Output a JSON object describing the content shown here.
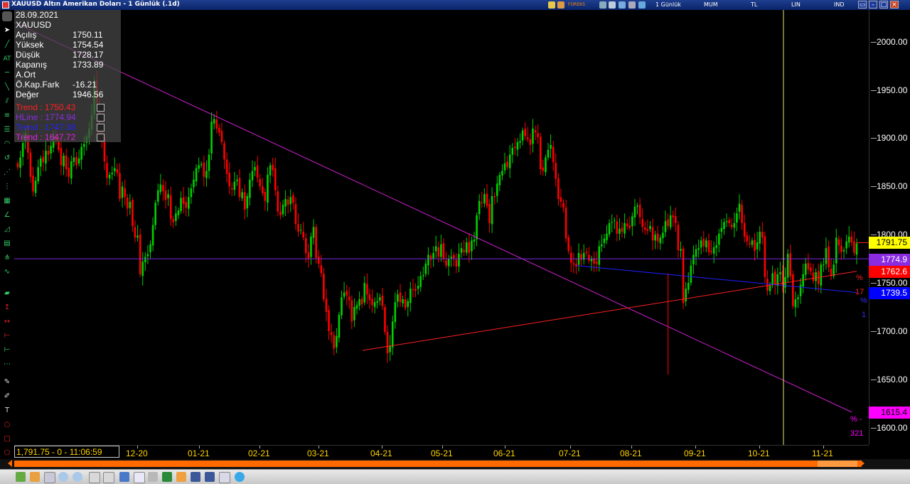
{
  "window": {
    "title": "XAUUSD Altın Amerikan Doları - 1 Günlük (.1d)"
  },
  "toolbar": {
    "period": "1 Günlük",
    "chart_type": "MUM",
    "currency": "TL",
    "scale": "LIN",
    "indicator": "IND",
    "brand": "FOREKS"
  },
  "info_panel": {
    "date": "28.09.2021",
    "symbol": "XAUUSD",
    "rows": [
      {
        "label": "Açılış",
        "value": "1750.11"
      },
      {
        "label": "Yüksek",
        "value": "1754.54"
      },
      {
        "label": "Düşük",
        "value": "1728.17"
      },
      {
        "label": "Kapanış",
        "value": "1733.89"
      },
      {
        "label": "A.Ort",
        "value": ""
      },
      {
        "label": "Ö.Kap.Fark",
        "value": "-16.21"
      },
      {
        "label": "Değer",
        "value": "1946.56"
      }
    ],
    "trends": [
      {
        "text": "Trend : 1750.43",
        "color": "#ff2020"
      },
      {
        "text": "HLine : 1774.94",
        "color": "#8a2be2"
      },
      {
        "text": "Trend : 1747.38",
        "color": "#2020ff"
      },
      {
        "text": "Trend : 1647.72",
        "color": "#e020e0"
      }
    ]
  },
  "status": {
    "value": "1,791.75 - 0 - 11:06:59"
  },
  "price_boxes": [
    {
      "value": "1791.75",
      "bg": "#ffff00",
      "fg": "#000000"
    },
    {
      "value": "1774.9",
      "bg": "#8a2be2",
      "fg": "#ffffff"
    },
    {
      "value": "1762.6",
      "bg": "#ff0000",
      "fg": "#ffffff"
    },
    {
      "value": "1739.5",
      "bg": "#0000ff",
      "fg": "#ffffff"
    },
    {
      "value": "1615.4",
      "bg": "#ff00ff",
      "fg": "#000000"
    }
  ],
  "edge_labels": [
    {
      "text": "%",
      "color": "#ff2020"
    },
    {
      "text": "17",
      "color": "#ff2020"
    },
    {
      "text": "%",
      "color": "#3030ff"
    },
    {
      "text": "1",
      "color": "#3030ff"
    },
    {
      "text": "% -",
      "color": "#ff00ff"
    },
    {
      "text": "321",
      "color": "#ff00ff"
    }
  ],
  "chart_data": {
    "type": "candlestick",
    "x_tick_labels": [
      "12-20",
      "01-21",
      "02-21",
      "03-21",
      "04-21",
      "05-21",
      "06-21",
      "07-21",
      "08-21",
      "09-21",
      "10-21",
      "11-21"
    ],
    "y_tick_labels": [
      "1600.00",
      "1650.00",
      "1700.00",
      "1750.00",
      "1800.00",
      "1850.00",
      "1900.00",
      "1950.00",
      "2000.00"
    ],
    "ylim": [
      1582,
      2033
    ],
    "up_color": "#00d000",
    "down_color": "#ff0000",
    "closes": [
      1870,
      1880,
      1895,
      1905,
      1885,
      1860,
      1845,
      1856,
      1870,
      1879,
      1875,
      1887,
      1883,
      1892,
      1903,
      1897,
      1888,
      1872,
      1882,
      1868,
      1860,
      1876,
      1880,
      1872,
      1879,
      1891,
      1894,
      1902,
      1910,
      1924,
      1958,
      1937,
      1905,
      1900,
      1876,
      1859,
      1862,
      1864,
      1869,
      1864,
      1837,
      1850,
      1839,
      1827,
      1834,
      1809,
      1797,
      1799,
      1759,
      1772,
      1777,
      1780,
      1790,
      1810,
      1833,
      1846,
      1852,
      1845,
      1836,
      1842,
      1816,
      1813,
      1822,
      1825,
      1838,
      1832,
      1828,
      1839,
      1848,
      1857,
      1869,
      1872,
      1873,
      1860,
      1866,
      1883,
      1917,
      1920,
      1910,
      1906,
      1896,
      1878,
      1863,
      1850,
      1847,
      1855,
      1857,
      1839,
      1844,
      1826,
      1840,
      1857,
      1866,
      1870,
      1859,
      1850,
      1843,
      1835,
      1862,
      1872,
      1867,
      1846,
      1824,
      1820,
      1831,
      1837,
      1831,
      1839,
      1833,
      1811,
      1803,
      1805,
      1797,
      1781,
      1775,
      1798,
      1808,
      1776,
      1770,
      1760,
      1733,
      1720,
      1700,
      1696,
      1682,
      1695,
      1717,
      1735,
      1740,
      1737,
      1732,
      1710,
      1725,
      1727,
      1733,
      1728,
      1750,
      1738,
      1732,
      1727,
      1730,
      1731,
      1735,
      1726,
      1699,
      1677,
      1685,
      1710,
      1730,
      1738,
      1730,
      1733,
      1724,
      1731,
      1744,
      1743,
      1742,
      1747,
      1757,
      1758,
      1770,
      1779,
      1774,
      1781,
      1788,
      1777,
      1790,
      1775,
      1768,
      1775,
      1777,
      1775,
      1767,
      1780,
      1786,
      1782,
      1792,
      1781,
      1794,
      1795,
      1820,
      1835,
      1833,
      1842,
      1830,
      1812,
      1840,
      1839,
      1853,
      1862,
      1866,
      1874,
      1870,
      1883,
      1890,
      1890,
      1896,
      1897,
      1908,
      1902,
      1899,
      1893,
      1910,
      1906,
      1901,
      1868,
      1866,
      1880,
      1888,
      1893,
      1875,
      1858,
      1837,
      1834,
      1828,
      1796,
      1783,
      1771,
      1769,
      1767,
      1781,
      1774,
      1781,
      1781,
      1773,
      1775,
      1770,
      1770,
      1788,
      1790,
      1796,
      1801,
      1812,
      1813,
      1815,
      1801,
      1806,
      1803,
      1812,
      1809,
      1807,
      1819,
      1829,
      1830,
      1818,
      1808,
      1805,
      1804,
      1809,
      1794,
      1800,
      1793,
      1797,
      1802,
      1814,
      1809,
      1820,
      1818,
      1812,
      1784,
      1785,
      1729,
      1744,
      1750,
      1768,
      1779,
      1785,
      1786,
      1794,
      1788,
      1794,
      1782,
      1782,
      1787,
      1789,
      1801,
      1807,
      1813,
      1814,
      1812,
      1808,
      1812,
      1822,
      1832,
      1812,
      1798,
      1793,
      1790,
      1794,
      1783,
      1792,
      1803,
      1797,
      1756,
      1742,
      1747,
      1760,
      1748,
      1759,
      1761,
      1747,
      1756,
      1780,
      1757,
      1726,
      1733,
      1735,
      1748,
      1759,
      1770,
      1764,
      1762,
      1752,
      1761,
      1749,
      1769,
      1769,
      1786,
      1766,
      1757,
      1769,
      1797,
      1789,
      1782,
      1784,
      1793,
      1798,
      1792,
      1781,
      1791
    ]
  }
}
